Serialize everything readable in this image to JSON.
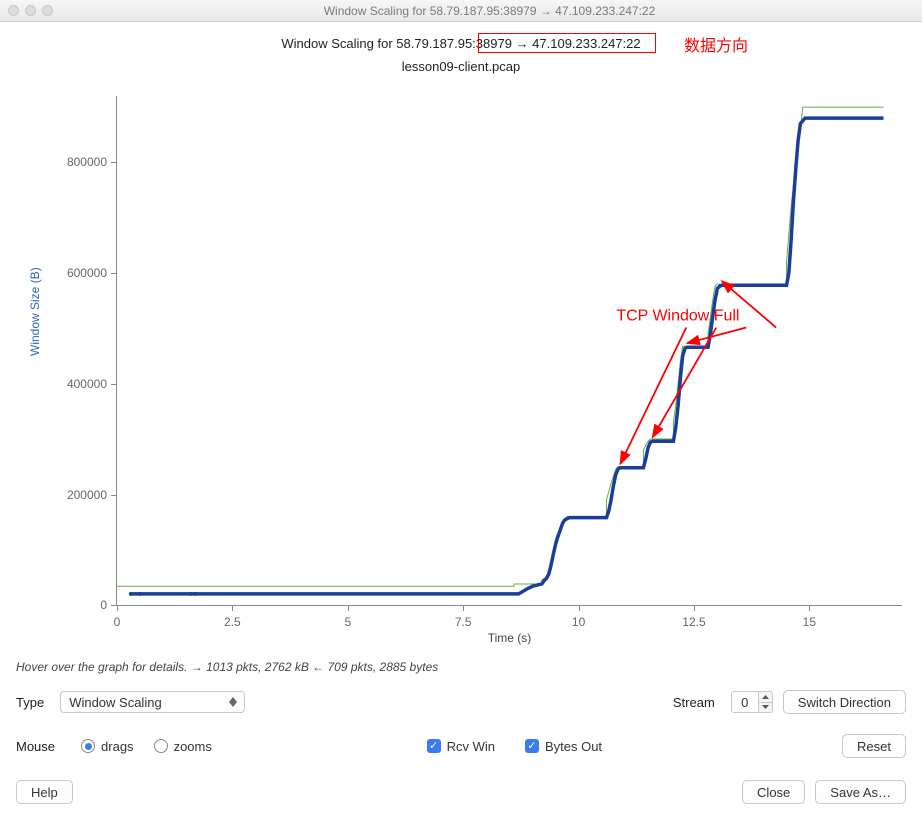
{
  "window": {
    "title": "Window Scaling for 58.79.187.95:38979 → 47.109.233.247:22"
  },
  "chart_data": {
    "type": "line",
    "title": "Window Scaling for 58.79.187.95:38979 → 47.109.233.247:22",
    "subtitle": "lesson09-client.pcap",
    "xlabel": "Time (s)",
    "ylabel": "Window Size (B)",
    "xlim": [
      0,
      17
    ],
    "ylim": [
      -20000,
      900000
    ],
    "xticks": [
      0,
      2.5,
      5,
      7.5,
      10,
      12.5,
      15
    ],
    "yticks": [
      0,
      200000,
      400000,
      600000,
      800000
    ],
    "series": [
      {
        "name": "Rcv Win",
        "color": "#6aa84f",
        "style": "thin",
        "data": [
          [
            0,
            14000
          ],
          [
            8.6,
            14000
          ],
          [
            8.6,
            18000
          ],
          [
            9.2,
            18000
          ],
          [
            9.2,
            26000
          ],
          [
            9.3,
            30000
          ],
          [
            9.35,
            42000
          ],
          [
            9.4,
            60000
          ],
          [
            9.45,
            80000
          ],
          [
            9.5,
            100000
          ],
          [
            9.6,
            120000
          ],
          [
            9.7,
            136000
          ],
          [
            9.75,
            140000
          ],
          [
            10.6,
            140000
          ],
          [
            10.6,
            170000
          ],
          [
            10.7,
            200000
          ],
          [
            10.8,
            225000
          ],
          [
            10.85,
            230000
          ],
          [
            11.4,
            230000
          ],
          [
            11.4,
            260000
          ],
          [
            11.5,
            276000
          ],
          [
            11.55,
            280000
          ],
          [
            12.05,
            280000
          ],
          [
            12.05,
            310000
          ],
          [
            12.1,
            340000
          ],
          [
            12.15,
            380000
          ],
          [
            12.2,
            420000
          ],
          [
            12.25,
            448000
          ],
          [
            12.8,
            448000
          ],
          [
            12.8,
            470000
          ],
          [
            12.85,
            500000
          ],
          [
            12.9,
            530000
          ],
          [
            12.95,
            556000
          ],
          [
            13.0,
            560000
          ],
          [
            14.5,
            560000
          ],
          [
            14.5,
            600000
          ],
          [
            14.6,
            700000
          ],
          [
            14.7,
            780000
          ],
          [
            14.8,
            840000
          ],
          [
            14.85,
            880000
          ],
          [
            16.6,
            880000
          ]
        ]
      },
      {
        "name": "Bytes Out",
        "color": "#1b3e9c",
        "style": "thick",
        "data": [
          [
            0.3,
            0
          ],
          [
            0.5,
            0
          ],
          [
            1.6,
            0
          ],
          [
            1.7,
            0
          ],
          [
            8.7,
            0
          ],
          [
            8.9,
            10000
          ],
          [
            9.0,
            14000
          ],
          [
            9.1,
            16000
          ],
          [
            9.2,
            18000
          ],
          [
            9.25,
            24000
          ],
          [
            9.3,
            28000
          ],
          [
            9.35,
            36000
          ],
          [
            9.4,
            52000
          ],
          [
            9.45,
            72000
          ],
          [
            9.5,
            90000
          ],
          [
            9.55,
            104000
          ],
          [
            9.6,
            116000
          ],
          [
            9.65,
            128000
          ],
          [
            9.7,
            134000
          ],
          [
            9.75,
            136000
          ],
          [
            9.8,
            138000
          ],
          [
            10.6,
            138000
          ],
          [
            10.65,
            150000
          ],
          [
            10.7,
            170000
          ],
          [
            10.75,
            195000
          ],
          [
            10.8,
            215000
          ],
          [
            10.85,
            226000
          ],
          [
            10.9,
            228000
          ],
          [
            11.4,
            228000
          ],
          [
            11.45,
            244000
          ],
          [
            11.5,
            264000
          ],
          [
            11.55,
            274000
          ],
          [
            11.6,
            276000
          ],
          [
            12.05,
            276000
          ],
          [
            12.1,
            300000
          ],
          [
            12.15,
            340000
          ],
          [
            12.2,
            390000
          ],
          [
            12.25,
            430000
          ],
          [
            12.3,
            444000
          ],
          [
            12.35,
            446000
          ],
          [
            12.8,
            446000
          ],
          [
            12.85,
            470000
          ],
          [
            12.9,
            500000
          ],
          [
            12.95,
            530000
          ],
          [
            13.0,
            552000
          ],
          [
            13.05,
            556000
          ],
          [
            13.1,
            558000
          ],
          [
            14.5,
            558000
          ],
          [
            14.55,
            580000
          ],
          [
            14.6,
            640000
          ],
          [
            14.65,
            710000
          ],
          [
            14.7,
            770000
          ],
          [
            14.75,
            820000
          ],
          [
            14.8,
            850000
          ],
          [
            14.9,
            860000
          ],
          [
            16.6,
            860000
          ]
        ]
      }
    ],
    "annotations": {
      "header_red_box": {
        "target": "38979 → 47.109.233.247:22"
      },
      "data_direction_label": "数据方向",
      "tcp_window_full_label": "TCP Window Full",
      "tcp_window_full_points": [
        [
          10.9,
          228000
        ],
        [
          11.6,
          276000
        ],
        [
          12.35,
          446000
        ],
        [
          13.1,
          558000
        ]
      ]
    }
  },
  "hover_line": "Hover over the graph for details. → 1013 pkts, 2762 kB ← 709 pkts, 2885 bytes",
  "controls": {
    "type_label": "Type",
    "type_value": "Window Scaling",
    "stream_label": "Stream",
    "stream_value": "0",
    "switch_direction": "Switch Direction",
    "mouse_label": "Mouse",
    "mouse_drags": "drags",
    "mouse_zooms": "zooms",
    "mouse_selected": "drags",
    "rcv_win": "Rcv Win",
    "bytes_out": "Bytes Out",
    "reset": "Reset"
  },
  "footer": {
    "help": "Help",
    "close": "Close",
    "save_as": "Save As…"
  }
}
